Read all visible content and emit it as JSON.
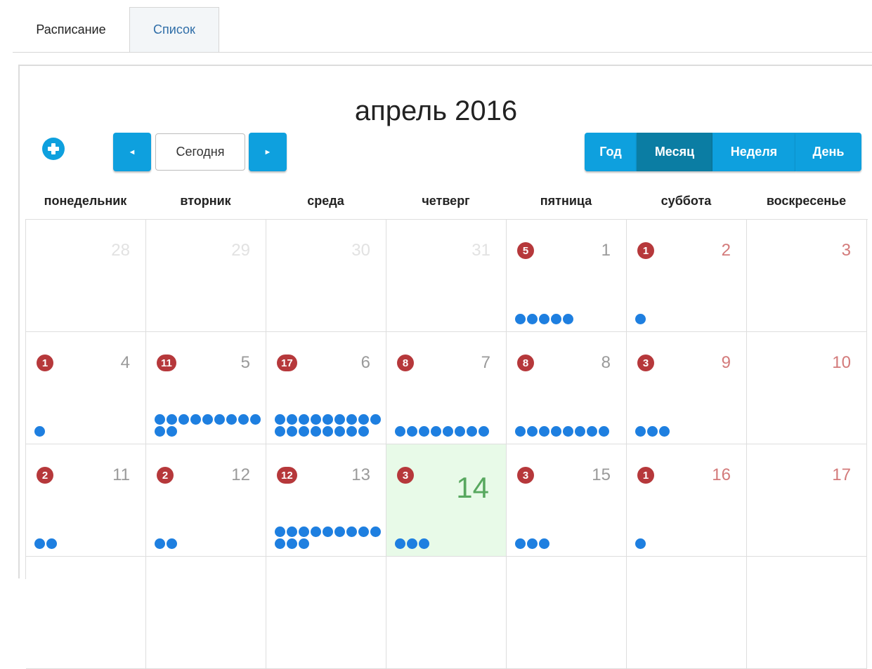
{
  "tabs": {
    "schedule": "Расписание",
    "list": "Список"
  },
  "calendar_title": "апрель 2016",
  "toolbar": {
    "today": "Сегодня",
    "prev_icon": "◄",
    "next_icon": "►"
  },
  "views": [
    "Год",
    "Месяц",
    "Неделя",
    "День"
  ],
  "active_view": "Месяц",
  "weekdays": [
    "понедельник",
    "вторник",
    "среда",
    "четверг",
    "пятница",
    "суббота",
    "воскресенье"
  ],
  "colors": {
    "accent": "#0ea0de",
    "accent_active": "#0b7da3",
    "badge": "#b6383b",
    "dot": "#1e7fe0",
    "today_bg": "#e8fae8",
    "weekend": "#d37a7a"
  },
  "weeks": [
    [
      {
        "day": "28",
        "count": null,
        "dots": 0,
        "other": true
      },
      {
        "day": "29",
        "count": null,
        "dots": 0,
        "other": true
      },
      {
        "day": "30",
        "count": null,
        "dots": 0,
        "other": true
      },
      {
        "day": "31",
        "count": null,
        "dots": 0,
        "other": true
      },
      {
        "day": "1",
        "count": "5",
        "dots": 5
      },
      {
        "day": "2",
        "count": "1",
        "dots": 1,
        "weekend": true
      },
      {
        "day": "3",
        "count": null,
        "dots": 0,
        "weekend": true
      }
    ],
    [
      {
        "day": "4",
        "count": "1",
        "dots": 1
      },
      {
        "day": "5",
        "count": "11",
        "dots": 11
      },
      {
        "day": "6",
        "count": "17",
        "dots": 17
      },
      {
        "day": "7",
        "count": "8",
        "dots": 8
      },
      {
        "day": "8",
        "count": "8",
        "dots": 8
      },
      {
        "day": "9",
        "count": "3",
        "dots": 3,
        "weekend": true
      },
      {
        "day": "10",
        "count": null,
        "dots": 0,
        "weekend": true
      }
    ],
    [
      {
        "day": "11",
        "count": "2",
        "dots": 2
      },
      {
        "day": "12",
        "count": "2",
        "dots": 2
      },
      {
        "day": "13",
        "count": "12",
        "dots": 12
      },
      {
        "day": "14",
        "count": "3",
        "dots": 3,
        "today": true
      },
      {
        "day": "15",
        "count": "3",
        "dots": 3
      },
      {
        "day": "16",
        "count": "1",
        "dots": 1,
        "weekend": true
      },
      {
        "day": "17",
        "count": null,
        "dots": 0,
        "weekend": true
      }
    ]
  ]
}
